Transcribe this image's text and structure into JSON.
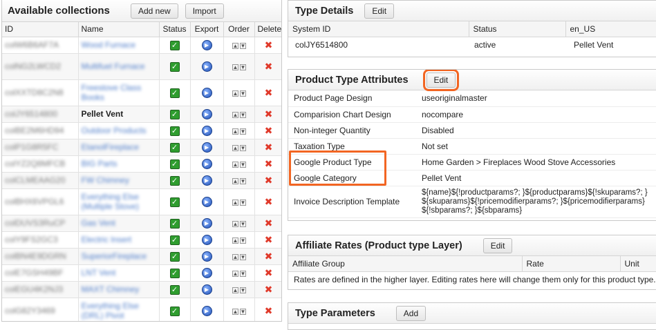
{
  "collections": {
    "title": "Available collections",
    "add_new_label": "Add new",
    "import_label": "Import",
    "columns": [
      "ID",
      "Name",
      "Status",
      "Export",
      "Order",
      "Delete"
    ],
    "rows": [
      {
        "id": "colW6B6AF7A",
        "name": "Wood Furnace",
        "blurred": true,
        "two_line": false
      },
      {
        "id": "colNG2LWCD2",
        "name": "Multifuel Furnace",
        "blurred": true,
        "two_line": true
      },
      {
        "id": "colXXTD8C2N8",
        "name": "Freestove Class Books",
        "blurred": true,
        "two_line": true
      },
      {
        "id": "colJY6514800",
        "name": "Pellet Vent",
        "blurred": true,
        "two_line": false,
        "selected": true
      },
      {
        "id": "colBE2M6HD94",
        "name": "Outdoor Products",
        "blurred": true,
        "two_line": false
      },
      {
        "id": "colP1G8R5FC",
        "name": "EtanolFireplace",
        "blurred": true,
        "two_line": false
      },
      {
        "id": "colYZ2Q8MFCB",
        "name": "BIG Parts",
        "blurred": true,
        "two_line": false
      },
      {
        "id": "colCLMEAAG20",
        "name": "FW Chimney",
        "blurred": true,
        "two_line": false
      },
      {
        "id": "colBHX6VPGL6",
        "name": "Everything Else (Multiple Stove)",
        "blurred": true,
        "two_line": true
      },
      {
        "id": "colDUVS3RuCP",
        "name": "Gas Vent",
        "blurred": true,
        "two_line": false
      },
      {
        "id": "colY9FS2GC3",
        "name": "Electric Insert",
        "blurred": true,
        "two_line": false
      },
      {
        "id": "colBN4E9DGRN",
        "name": "SuperiorFireplace",
        "blurred": true,
        "two_line": false
      },
      {
        "id": "colE7GSH49BF",
        "name": "LNT Vent",
        "blurred": true,
        "two_line": false
      },
      {
        "id": "colEGU4K2NJ3",
        "name": "MAXT Chimney",
        "blurred": true,
        "two_line": false
      },
      {
        "id": "colG82Y3469",
        "name": "Everything Else (DRL) Pivot",
        "blurred": true,
        "two_line": true
      }
    ],
    "selected_name_visible": "Pellet Vent"
  },
  "type_details": {
    "title": "Type Details",
    "edit_label": "Edit",
    "columns": [
      "System ID",
      "Status",
      "en_US"
    ],
    "row": [
      "colJY6514800",
      "active",
      "Pellet Vent"
    ]
  },
  "product_type_attributes": {
    "title": "Product Type Attributes",
    "edit_label": "Edit",
    "rows": [
      {
        "label": "Product Page Design",
        "value": "useoriginalmaster"
      },
      {
        "label": "Comparision Chart Design",
        "value": "nocompare"
      },
      {
        "label": "Non-integer Quantity",
        "value": "Disabled"
      },
      {
        "label": "Taxation Type",
        "value": "Not set"
      },
      {
        "label": "Google Product Type",
        "value": "Home Garden > Fireplaces Wood Stove Accessories"
      },
      {
        "label": "Google Category",
        "value": "Pellet Vent"
      },
      {
        "label": "Invoice Description Template",
        "value": "${name}${!productparams?; }${productparams}${!skuparams?; }${skuparams}${!pricemodifierparams?; }${pricemodifierparams}${!sbparams?; }${sbparams}"
      }
    ]
  },
  "affiliate_rates": {
    "title": "Affiliate Rates (Product type Layer)",
    "edit_label": "Edit",
    "columns": [
      "Affiliate Group",
      "Rate",
      "Unit"
    ],
    "note": "Rates are defined in the higher layer. Editing rates here will change them only for this product type."
  },
  "type_parameters": {
    "title": "Type Parameters",
    "add_label": "Add"
  },
  "colors": {
    "highlight": "#f26522",
    "link": "#4f7dc9",
    "status_check": "#2f9d2f",
    "delete": "#e03a2b"
  },
  "icons": {
    "status": "check-icon",
    "export": "export-icon",
    "order": "order-arrows-icon",
    "delete": "delete-icon"
  }
}
